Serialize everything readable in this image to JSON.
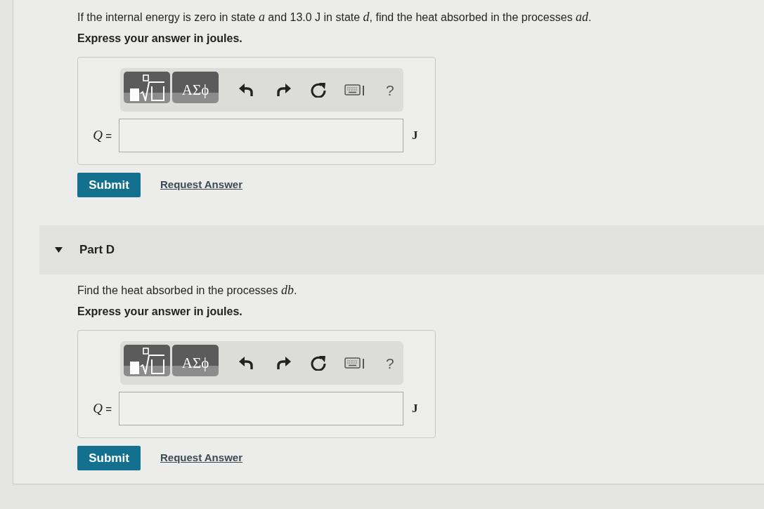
{
  "parts": [
    {
      "question": "If the internal energy is zero in state *a* and 13.0 J in state *d*, find the heat absorbed in the processes *ad*.",
      "instruction": "Express your answer in joules.",
      "answer": {
        "symbols_label": "ΑΣϕ",
        "help_label": "?",
        "variable": "*Q* =",
        "unit": "J"
      },
      "submit": "Submit",
      "request_answer": "Request Answer"
    },
    {
      "header": {
        "title": "Part D",
        "expanded": true
      },
      "question": "Find the heat absorbed in the processes *db*.",
      "instruction": "Express your answer in joules.",
      "answer": {
        "symbols_label": "ΑΣϕ",
        "help_label": "?",
        "variable": "*Q* =",
        "unit": "J"
      },
      "submit": "Submit",
      "request_answer": "Request Answer"
    }
  ]
}
